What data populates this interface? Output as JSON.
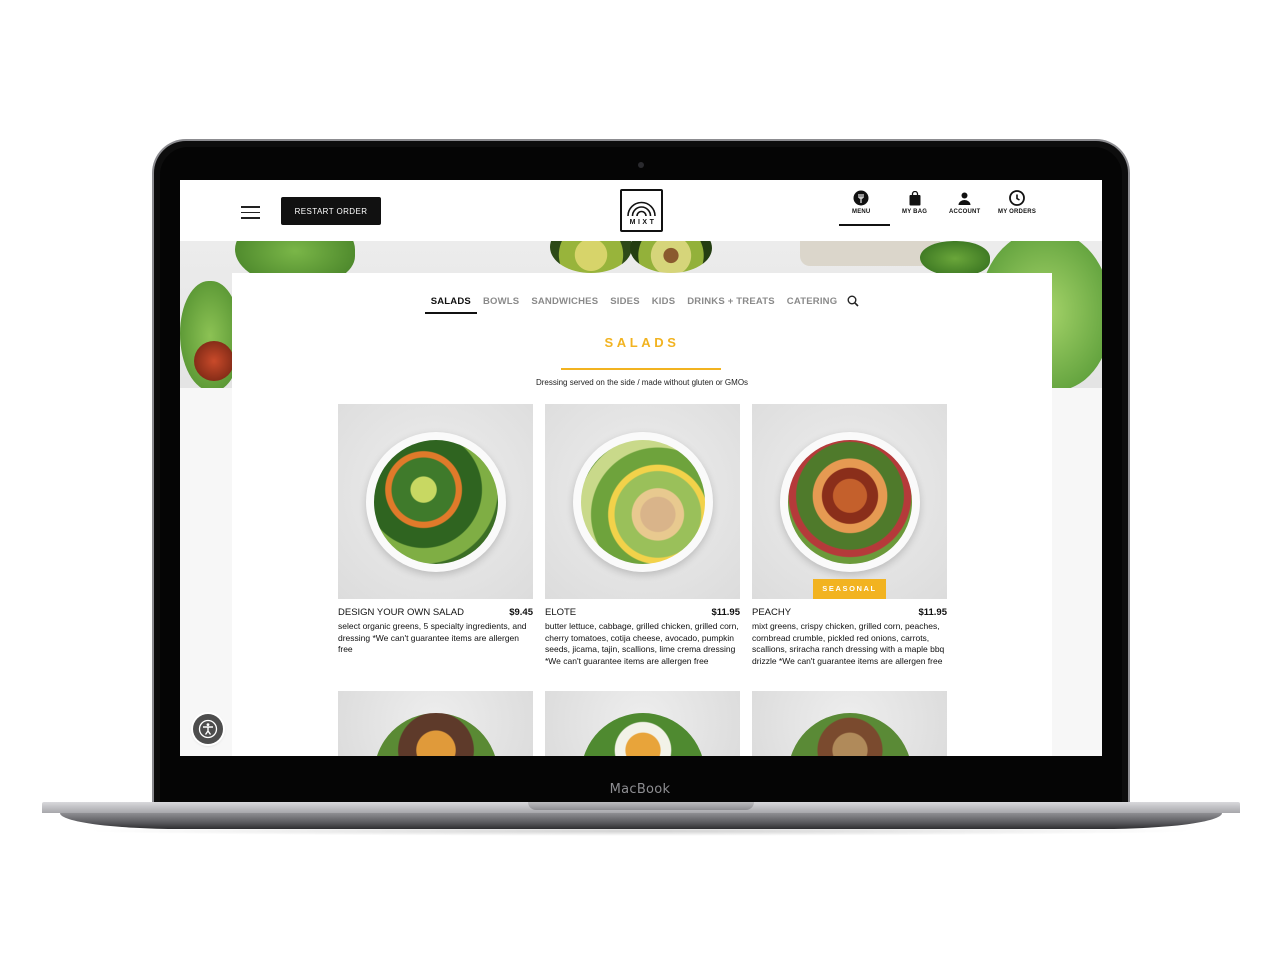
{
  "device": {
    "label": "MacBook"
  },
  "header": {
    "restart_label": "RESTART ORDER",
    "logo_text": "MIXT",
    "nav": [
      {
        "label": "MENU",
        "icon": "fork-icon"
      },
      {
        "label": "MY BAG",
        "icon": "bag-icon"
      },
      {
        "label": "ACCOUNT",
        "icon": "user-icon"
      },
      {
        "label": "MY ORDERS",
        "icon": "orders-icon"
      }
    ]
  },
  "tabs": [
    "SALADS",
    "BOWLS",
    "SANDWICHES",
    "SIDES",
    "KIDS",
    "DRINKS + TREATS",
    "CATERING"
  ],
  "active_tab": "SALADS",
  "section": {
    "title": "SALADS",
    "subtitle": "Dressing served on the side / made without gluten or GMOs"
  },
  "items": [
    {
      "name": "DESIGN YOUR OWN SALAD",
      "price": "$9.45",
      "description": "select organic greens, 5 specialty ingredients, and dressing *We can't guarantee items are allergen free",
      "badge": ""
    },
    {
      "name": "ELOTE",
      "price": "$11.95",
      "description": "butter lettuce, cabbage, grilled chicken, grilled corn, cherry tomatoes, cotija cheese, avocado, pumpkin seeds, jicama, tajin, scallions, lime crema dressing *We can't guarantee items are allergen free",
      "badge": ""
    },
    {
      "name": "PEACHY",
      "price": "$11.95",
      "description": "mixt greens, crispy chicken, grilled corn, peaches, cornbread crumble, pickled red onions, carrots, scallions, sriracha ranch dressing with a maple bbq drizzle *We can't guarantee items are allergen free",
      "badge": "SEASONAL"
    }
  ],
  "colors": {
    "accent": "#f2b320",
    "dark": "#111111"
  }
}
